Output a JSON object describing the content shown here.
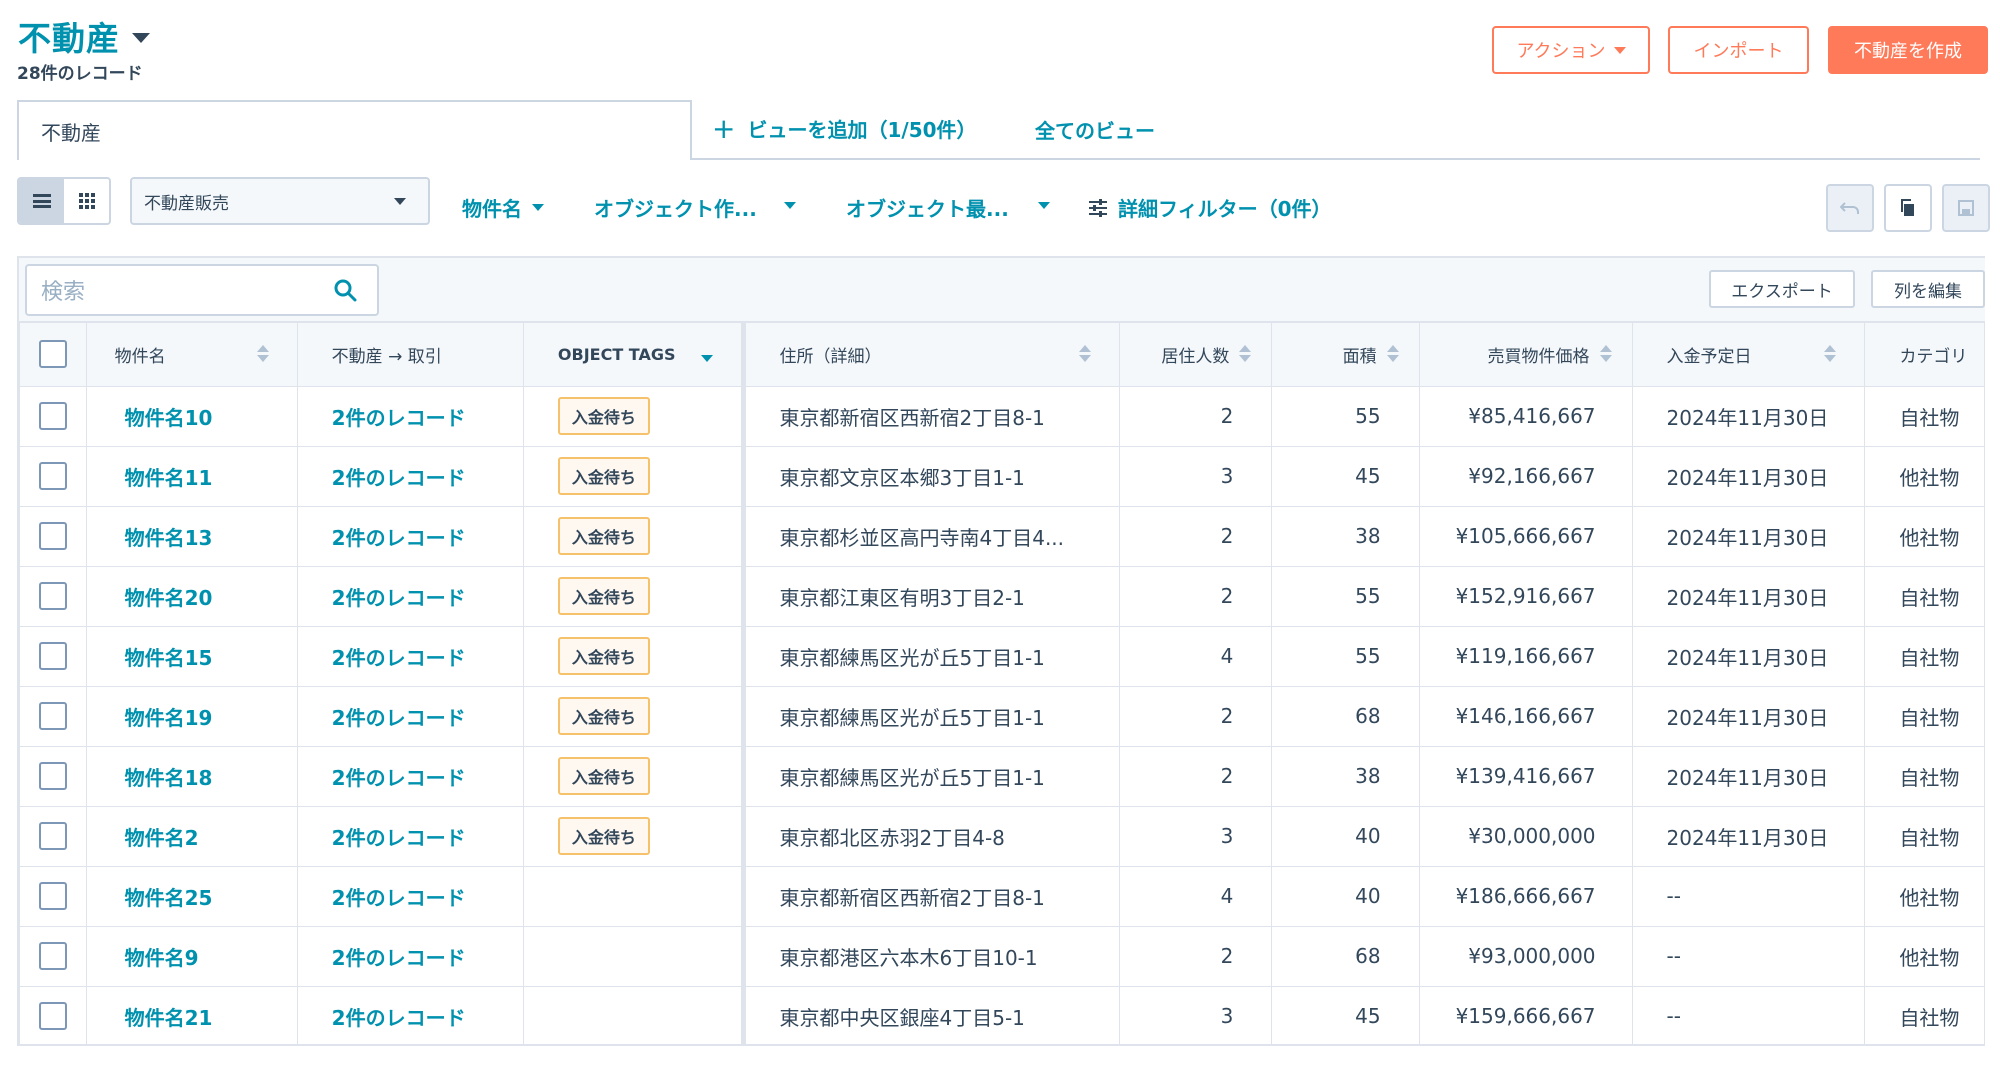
{
  "header": {
    "title": "不動産",
    "record_count": "28件のレコード",
    "actions_label": "アクション",
    "import_label": "インポート",
    "create_label": "不動産を作成"
  },
  "views": {
    "active_tab": "不動産",
    "add_view": "ビューを追加（1/50件）",
    "all_views": "全てのビュー"
  },
  "filters": {
    "pipeline": "不動産販売",
    "name_filter": "物件名",
    "created_filter": "オブジェクト作...",
    "modified_filter": "オブジェクト最...",
    "advanced_filter": "詳細フィルター（0件）"
  },
  "table_tools": {
    "search_placeholder": "検索",
    "export_label": "エクスポート",
    "edit_columns_label": "列を編集"
  },
  "columns": [
    "物件名",
    "不動産 → 取引",
    "OBJECT TAGS",
    "住所（詳細）",
    "居住人数",
    "面積",
    "売買物件価格",
    "入金予定日",
    "カテゴリ"
  ],
  "rows": [
    {
      "name": "物件名10",
      "deals": "2件のレコード",
      "tag": "入金待ち",
      "address": "東京都新宿区西新宿2丁目8-1",
      "residents": "2",
      "area": "55",
      "price": "¥85,416,667",
      "date": "2024年11月30日",
      "category": "自社物"
    },
    {
      "name": "物件名11",
      "deals": "2件のレコード",
      "tag": "入金待ち",
      "address": "東京都文京区本郷3丁目1-1",
      "residents": "3",
      "area": "45",
      "price": "¥92,166,667",
      "date": "2024年11月30日",
      "category": "他社物"
    },
    {
      "name": "物件名13",
      "deals": "2件のレコード",
      "tag": "入金待ち",
      "address": "東京都杉並区高円寺南4丁目4...",
      "residents": "2",
      "area": "38",
      "price": "¥105,666,667",
      "date": "2024年11月30日",
      "category": "他社物"
    },
    {
      "name": "物件名20",
      "deals": "2件のレコード",
      "tag": "入金待ち",
      "address": "東京都江東区有明3丁目2-1",
      "residents": "2",
      "area": "55",
      "price": "¥152,916,667",
      "date": "2024年11月30日",
      "category": "自社物"
    },
    {
      "name": "物件名15",
      "deals": "2件のレコード",
      "tag": "入金待ち",
      "address": "東京都練馬区光が丘5丁目1-1",
      "residents": "4",
      "area": "55",
      "price": "¥119,166,667",
      "date": "2024年11月30日",
      "category": "自社物"
    },
    {
      "name": "物件名19",
      "deals": "2件のレコード",
      "tag": "入金待ち",
      "address": "東京都練馬区光が丘5丁目1-1",
      "residents": "2",
      "area": "68",
      "price": "¥146,166,667",
      "date": "2024年11月30日",
      "category": "自社物"
    },
    {
      "name": "物件名18",
      "deals": "2件のレコード",
      "tag": "入金待ち",
      "address": "東京都練馬区光が丘5丁目1-1",
      "residents": "2",
      "area": "38",
      "price": "¥139,416,667",
      "date": "2024年11月30日",
      "category": "自社物"
    },
    {
      "name": "物件名2",
      "deals": "2件のレコード",
      "tag": "入金待ち",
      "address": "東京都北区赤羽2丁目4-8",
      "residents": "3",
      "area": "40",
      "price": "¥30,000,000",
      "date": "2024年11月30日",
      "category": "自社物"
    },
    {
      "name": "物件名25",
      "deals": "2件のレコード",
      "tag": "",
      "address": "東京都新宿区西新宿2丁目8-1",
      "residents": "4",
      "area": "40",
      "price": "¥186,666,667",
      "date": "--",
      "category": "他社物"
    },
    {
      "name": "物件名9",
      "deals": "2件のレコード",
      "tag": "",
      "address": "東京都港区六本木6丁目10-1",
      "residents": "2",
      "area": "68",
      "price": "¥93,000,000",
      "date": "--",
      "category": "他社物"
    },
    {
      "name": "物件名21",
      "deals": "2件のレコード",
      "tag": "",
      "address": "東京都中央区銀座4丁目5-1",
      "residents": "3",
      "area": "45",
      "price": "¥159,666,667",
      "date": "--",
      "category": "自社物"
    }
  ],
  "colors": {
    "accent": "#0091ae",
    "primary_button": "#ff7a59",
    "tag_border": "#f5c26b",
    "text": "#33475b"
  }
}
